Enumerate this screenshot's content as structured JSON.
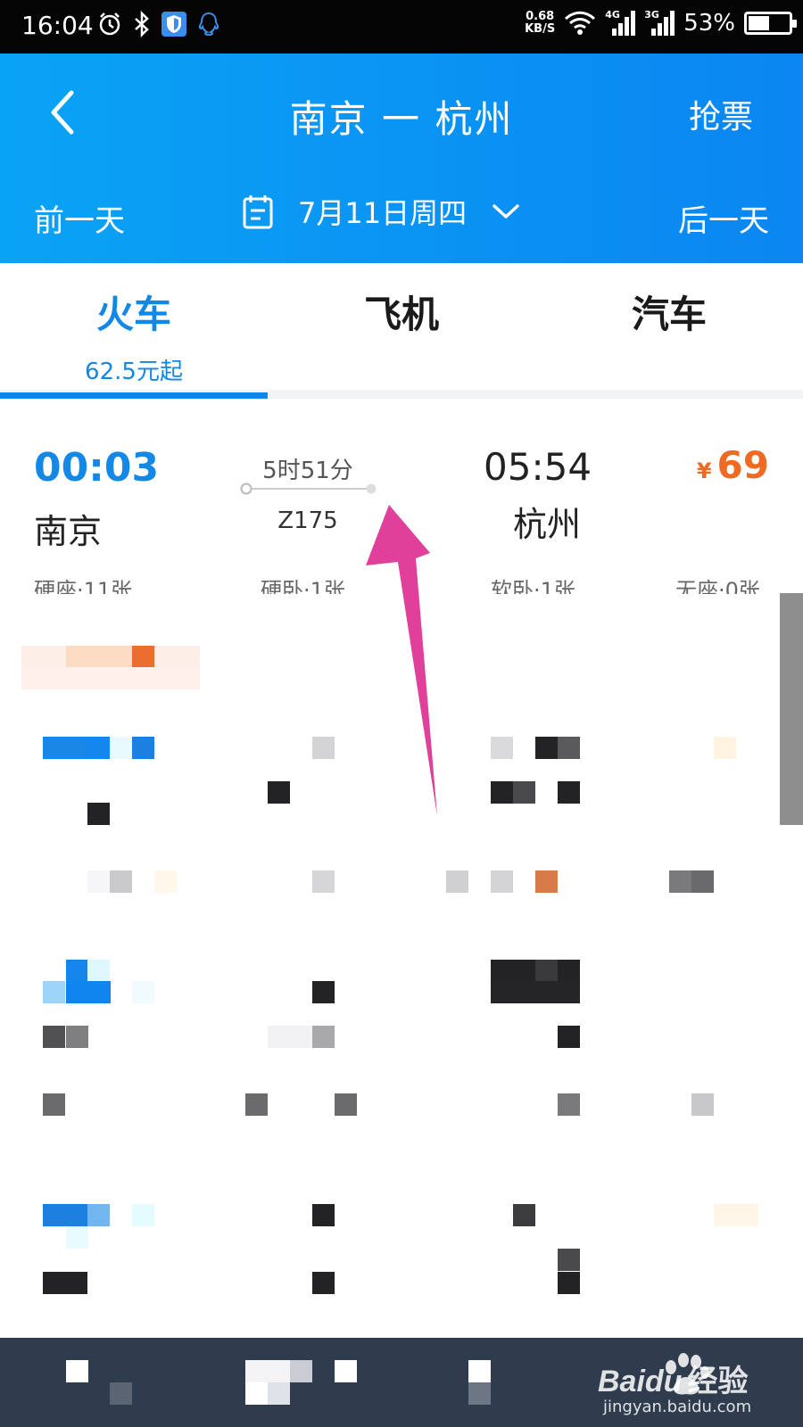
{
  "status_bar": {
    "time": "16:04",
    "net_speed_value": "0.68",
    "net_speed_unit": "KB/S",
    "net_4g": "4G",
    "net_3g": "3G",
    "battery": "53%",
    "battery_level": 0.53
  },
  "header": {
    "title": "南京 一 杭州",
    "grab_ticket": "抢票",
    "prev_day": "前一天",
    "next_day": "后一天",
    "date": "7月11日周四"
  },
  "tabs": [
    {
      "label": "火车",
      "sub": "62.5元起",
      "active": true
    },
    {
      "label": "飞机",
      "sub": "",
      "active": false
    },
    {
      "label": "汽车",
      "sub": "",
      "active": false
    }
  ],
  "train": {
    "depart_time": "00:03",
    "depart_station": "南京",
    "duration": "5时51分",
    "train_no": "Z175",
    "arrive_time": "05:54",
    "arrive_station": "杭州",
    "price_currency": "¥",
    "price": "69",
    "seats": [
      {
        "label": "硬座·11张"
      },
      {
        "label": "硬卧·1张"
      },
      {
        "label": "软卧·1张"
      },
      {
        "label": "无座·0张"
      }
    ]
  },
  "colors": {
    "header_start": "#09a3f5",
    "header_end": "#0b86f2",
    "accent_blue": "#1488e6",
    "price_orange": "#f06a24",
    "arrow_pink": "#e03f9a",
    "bottom_bar": "#2f3c4d"
  },
  "watermark": {
    "brand": "Baidu",
    "product": "经验",
    "url": "jingyan.baidu.com"
  }
}
